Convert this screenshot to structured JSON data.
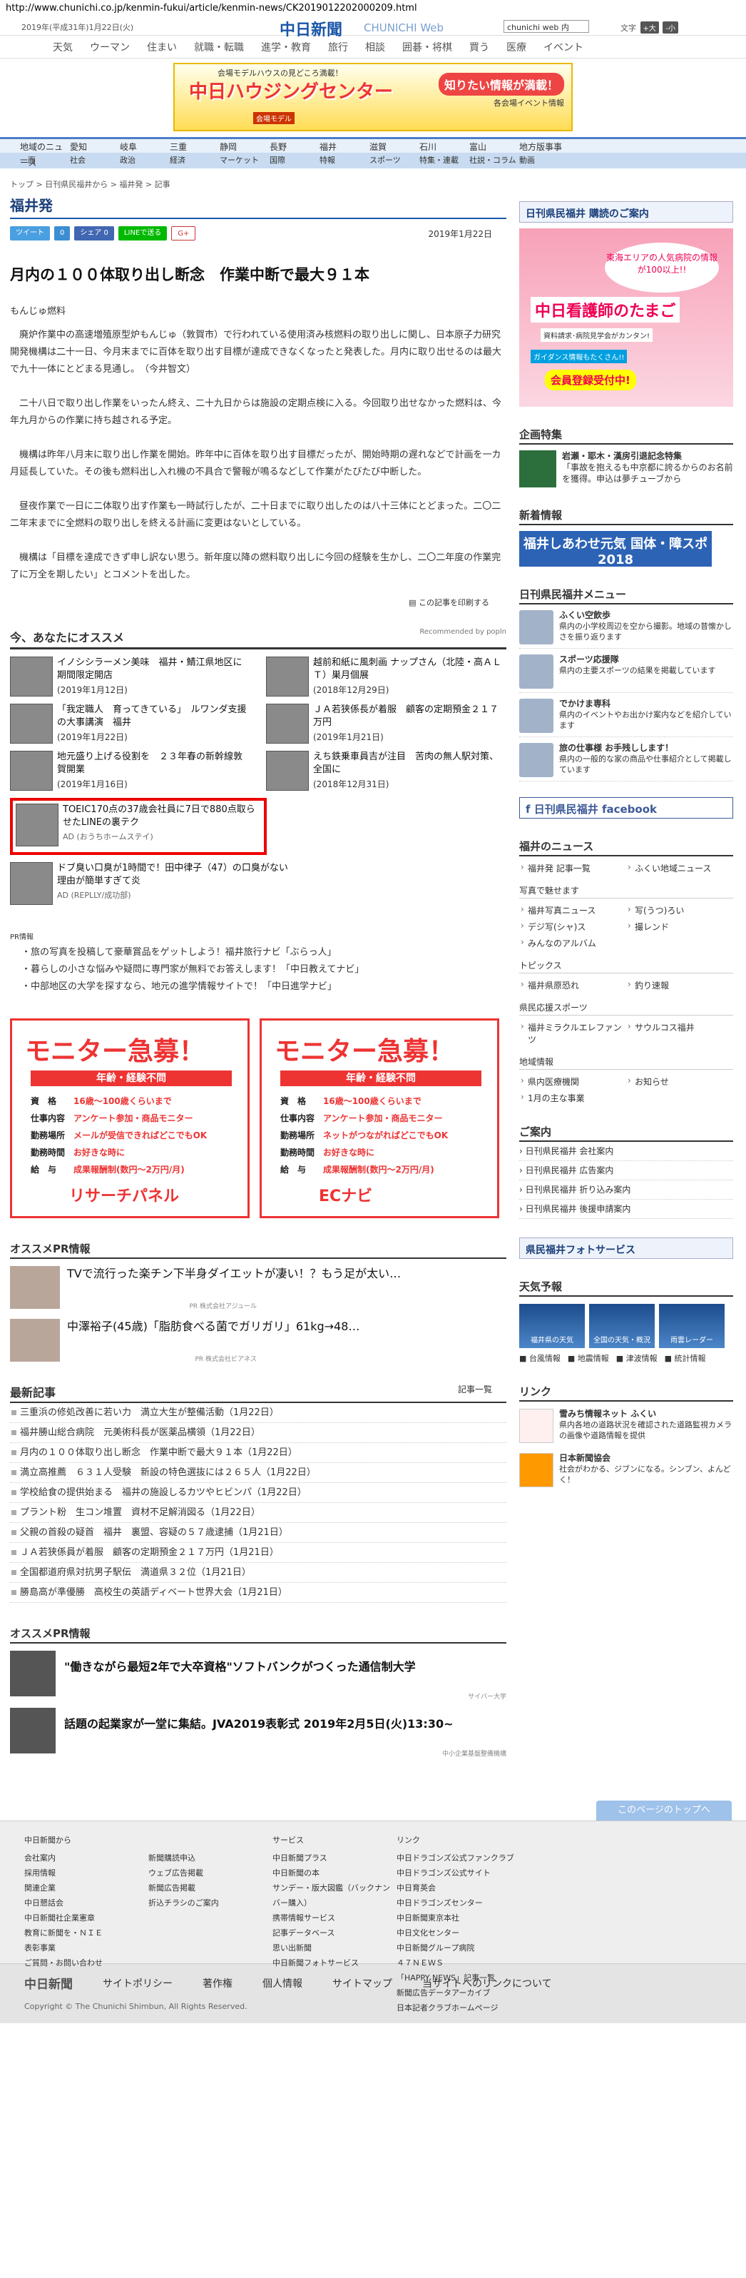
{
  "url": "http://www.chunichi.co.jp/kenmin-fukui/article/kenmin-news/CK2019012202000209.html",
  "header": {
    "date": "2019年(平成31年)1月22日(火)",
    "logo": "中日新聞",
    "logo_sub": "CHUNICHI Web",
    "search_value": "chunichi web 内",
    "font_label": "文字",
    "font_btns": [
      "+大",
      "-小"
    ]
  },
  "main_nav": [
    "天気",
    "ウーマン",
    "住まい",
    "就職・転職",
    "進学・教育",
    "旅行",
    "相談",
    "囲碁・将棋",
    "買う",
    "医療",
    "イベント"
  ],
  "banner": {
    "title": "中日ハウジングセンター",
    "tagline": "会場モデルハウスの見どころ満載！",
    "badge": "知りたい情報が満載！",
    "sub": "各会場イベント情報",
    "note": "会場モデル"
  },
  "region_nav": [
    "地域のニュース",
    "愛知",
    "岐阜",
    "三重",
    "静岡",
    "長野",
    "福井",
    "滋賀",
    "石川",
    "富山",
    "地方版事事"
  ],
  "section_nav": [
    "一面",
    "社会",
    "政治",
    "経済",
    "マーケット",
    "国際",
    "特報",
    "スポーツ",
    "特集・連載",
    "社説・コラム",
    "動画"
  ],
  "breadcrumb": "トップ > 日刊県民福井から > 福井発 > 記事",
  "page_title": "福井発",
  "share": [
    "ツイート",
    "0",
    "シェア 0",
    "LINEで送る",
    "G+"
  ],
  "pub_date": "2019年1月22日",
  "article": {
    "headline": "月内の１００体取り出し断念　作業中断で最大９１本",
    "author": "もんじゅ燃料",
    "paragraphs": [
      "廃炉作業中の高速増殖原型炉もんじゅ（敦賀市）で行われている使用済み核燃料の取り出しに関し、日本原子力研究開発機構は二十一日、今月末までに百体を取り出す目標が達成できなくなったと発表した。月内に取り出せるのは最大で九十一体にとどまる見通し。　（今井智文）",
      "二十八日で取り出し作業をいったん終え、二十九日からは施設の定期点検に入る。今回取り出せなかった燃料は、今年九月からの作業に持ち越される予定。",
      "機構は昨年八月末に取り出し作業を開始。昨年中に百体を取り出す目標だったが、開始時期の遅れなどで計画を一カ月延長していた。その後も燃料出し入れ機の不具合で警報が鳴るなどして作業がたびたび中断した。",
      "昼夜作業で一日に二体取り出す作業も一時試行したが、二十日までに取り出したのは八十三体にとどまった。二〇二二年末までに全燃料の取り出しを終える計画に変更はないとしている。",
      "機構は「目標を達成できず申し訳ない思う。新年度以降の燃料取り出しに今回の経験を生かし、二〇二年度の作業完了に万全を期したい」とコメントを出した。"
    ],
    "print_link": "この記事を印刷する"
  },
  "recommend": {
    "title": "今、あなたにオススメ",
    "powered": "Recommended by popln",
    "items": [
      {
        "title": "イノシシラーメン美味　福井・鯖江県地区に期間限定開店",
        "date": "(2019年1月12日)"
      },
      {
        "title": "越前和紙に風刺画 ナップさん（北陸・高ＡＬＴ）巣月個展",
        "date": "(2018年12月29日)"
      },
      {
        "title": "「我定職人　育ってきている」　ルワンダ支援の大事講演　福井",
        "date": "(2019年1月22日)"
      },
      {
        "title": "ＪＡ若狭係長が着服　顧客の定期預金２１７万円",
        "date": "(2019年1月21日)"
      },
      {
        "title": "地元盛り上げる役割を　２３年春の新幹線敦賀開業",
        "date": "(2019年1月16日)"
      },
      {
        "title": "えち鉄乗車員吉が注目　苦肉の無人駅対策、全国に",
        "date": "(2018年12月31日)"
      }
    ],
    "ad1_title": "TOEIC170点の37歳会社員に7日で880点取らせたLINEの裏テク",
    "ad1_src": "AD (おうちホームステイ)",
    "ad2_title": "ドブ臭い口臭が1時間で！田中律子（47）の口臭がない理由が簡単すぎて炎",
    "ad2_src": "AD (REPLLY/成功部)"
  },
  "pr": {
    "label": "PR情報",
    "items": [
      "旅の写真を投稿して豪華賞品をゲットしよう！福井旅行ナビ「ぶらっ人」",
      "暮らしの小さな悩みや疑問に専門家が無料でお答えします！「中日教えてナビ」",
      "中部地区の大学を探すなら、地元の進学情報サイトで！「中日進学ナビ」"
    ]
  },
  "monitor": {
    "title": "モニター急募！",
    "band": "年齢・経験不問",
    "rows": [
      {
        "k": "資　格",
        "v": "16歳〜100歳くらいまで"
      },
      {
        "k": "仕事内容",
        "v": "アンケート参加・商品モニター"
      },
      {
        "k": "勤務場所",
        "v": "メールが受信できればどこでもOK"
      },
      {
        "k": "勤務時間",
        "v": "お好きな時に"
      },
      {
        "k": "給　与",
        "v": "成果報酬制(数円〜2万円/月)"
      }
    ],
    "rows2": [
      {
        "k": "資　格",
        "v": "16歳〜100歳くらいまで"
      },
      {
        "k": "仕事内容",
        "v": "アンケート参加・商品モニター"
      },
      {
        "k": "勤務場所",
        "v": "ネットがつながればどこでもOK"
      },
      {
        "k": "勤務時間",
        "v": "お好きな時に"
      },
      {
        "k": "給　与",
        "v": "成果報酬制(数円〜2万円/月)"
      }
    ],
    "logo1": "リサーチパネル",
    "logo2": "ECナビ"
  },
  "pr2": {
    "title": "オススメPR情報",
    "items": [
      {
        "title": "TVで流行った楽チン下半身ダイエットが凄い！？もう足が太い…",
        "src": "PR 株式会社アジュール"
      },
      {
        "title": "中澤裕子(45歳)「脂肪食べる菌でガリガリ」61kg→48…",
        "src": "PR 株式会社ビアネス"
      }
    ]
  },
  "latest": {
    "title": "最新記事",
    "more": "記事一覧",
    "items": [
      "三重浜の修処改善に若い力　満立大生が整備活動（1月22日）",
      "福井勝山総合病院　元美術科長が医薬品横領（1月22日）",
      "月内の１００体取り出し断念　作業中断で最大９１本（1月22日）",
      "満立高推薦　６３１人受験　新設の特色選抜には２６５人（1月22日）",
      "学校給食の提供始まる　福井の施設しるカツやヒビンパ（1月22日）",
      "プラント粉　生コン堆置　資材不足解消図る（1月22日）",
      "父親の首殺の疑首　福井　裏盟、容疑の５７歳逮捕（1月21日）",
      "ＪＡ若狭係員が着服　顧客の定期預金２１７万円（1月21日）",
      "全国都道府県対抗男子駅伝　満道県３２位（1月21日）",
      "勝島高が準優勝　高校生の英語ディベート世界大会（1月21日）"
    ]
  },
  "pr3": {
    "title": "オススメPR情報",
    "items": [
      {
        "title": "\"働きながら最短2年で大卒資格\"ソフトバンクがつくった通信制大学",
        "src": "サイバー大学"
      },
      {
        "title": "話題の起業家が一堂に集結。JVA2019表彰式 2019年2月5日(火)13:30~",
        "src": "中小企業基盤整備機構"
      }
    ]
  },
  "sidebar": {
    "subscribe": "日刊県民福井 購読のご案内",
    "nurse": {
      "n1": "東海エリアの人気病院の情報が100以上!!",
      "n2": "中日看護師のたまご",
      "n3": "資料請求･病院見学会がカンタン!",
      "n4": "ガイダンス情報もたくさん!!",
      "n5": "会員登録受付中!"
    },
    "plan_title": "企画特集",
    "plan_item_title": "岩瀬・耶木・漢房引退記念特集",
    "plan_item_text": "「事故を抱えるも中京都に誇るからのお名前を獲得。申込は夢チューブから",
    "newest_title": "新着情報",
    "newest_banner": "福井しあわせ元気 国体・障スポ 2018",
    "menu_title": "日刊県民福井メニュー",
    "menu": [
      {
        "t": "ふくい空飲歩",
        "d": "県内の小学校周辺を空から撮影。地域の昔懐かしさを振り返ります"
      },
      {
        "t": "スポーツ応援隊",
        "d": "県内の主要スポーツの結果を掲載しています"
      },
      {
        "t": "でかけま専科",
        "d": "県内のイベントやお出かけ案内などを紹介しています"
      },
      {
        "t": "旅の仕事様 お手残しします！",
        "d": "県内の一般的な家の商品や仕事紹介として掲載しています"
      }
    ],
    "fb": "日刊県民福井 facebook",
    "local_title": "福井のニュース",
    "local_links": [
      "福井発 記事一覧",
      "ふくい地域ニュース"
    ],
    "photo_label": "写真で魅せます",
    "photo_links": [
      "福井写真ニュース",
      "写(うつ)ろい",
      "デジ写(シャ)ス",
      "撮レンド",
      "みんなのアルバム"
    ],
    "topics_label": "トピックス",
    "topics_links": [
      "福井県原恐れ",
      "釣り速報"
    ],
    "sports_label": "県民応援スポーツ",
    "sports_links": [
      "福井ミラクルエレファンツ",
      "サウルコス福井"
    ],
    "area_label": "地域情報",
    "area_links": [
      "県内医療機関",
      "お知らせ",
      "1月の主な事業"
    ],
    "guide_title": "ご案内",
    "guide_links": [
      "日刊県民福井 会社案内",
      "日刊県民福井 広告案内",
      "日刊県民福井 折り込み案内",
      "日刊県民福井 後援申請案内"
    ],
    "photo_service": "県民福井フォトサービス",
    "weather_title": "天気予報",
    "weather_boxes": [
      "福井県の天気",
      "全国の天気・概況",
      "雨雲レーダー"
    ],
    "weather_links": [
      "台風情報",
      "地震情報",
      "津波情報",
      "統計情報"
    ],
    "link_title": "リンク",
    "links": [
      {
        "t": "雪みち情報ネット ふくい",
        "d": "県内各地の道路状況を確認された道路監視カメラの画像や道路情報を提供"
      },
      {
        "t": "日本新聞協会",
        "d": "社会がわかる、ジブンになる。シンブン、よんどく！"
      }
    ]
  },
  "pagetop": "このページのトップへ",
  "footer": {
    "cols": [
      {
        "h": "中日新聞から",
        "items": [
          "会社案内",
          "採用情報",
          "関連企業",
          "中日懇話会",
          "中日新聞社企業憲章",
          "教育に新聞を・ＮＩＥ",
          "表彰事業",
          "ご質問・お問い合わせ"
        ]
      },
      {
        "h": "",
        "items": [
          "新聞購読申込",
          "ウェブ広告掲載",
          "新聞広告掲載",
          "折込チラシのご案内"
        ]
      },
      {
        "h": "サービス",
        "items": [
          "中日新聞プラス",
          "中日新聞の本",
          "サンデー・版大図鑑（バックナンバー購入）",
          "携帯情報サービス",
          "記事データベース",
          "思い出新聞",
          "中日新聞フォトサービス"
        ]
      },
      {
        "h": "リンク",
        "items": [
          "中日ドラゴンズ公式ファンクラブ",
          "中日ドラゴンズ公式サイト",
          "中日育英会",
          "中日ドラゴンズセンター",
          "中日新聞東京本社",
          "中日文化センター",
          "中日新聞グループ病院",
          "４７ＮＥＷＳ",
          "「HAPPY NEWS」記事一覧",
          "新聞広告データアーカイブ",
          "日本記者クラブホームページ"
        ]
      }
    ],
    "bottom_logo": "中日新聞",
    "bottom": [
      "サイトポリシー",
      "著作権",
      "個人情報",
      "サイトマップ",
      "当サイトへのリンクについて"
    ],
    "copyright": "Copyright © The Chunichi Shimbun, All Rights Reserved."
  }
}
